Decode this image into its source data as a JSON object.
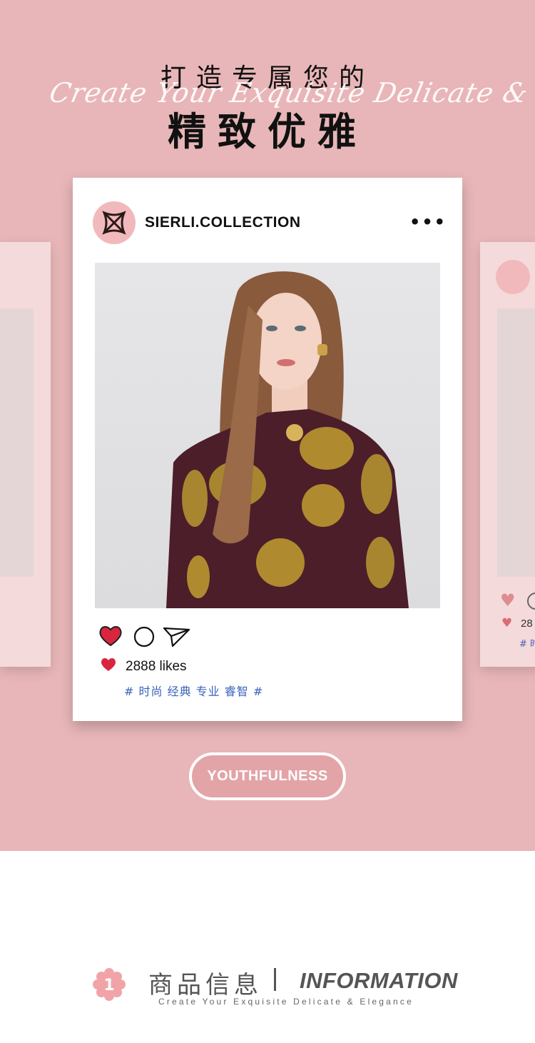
{
  "hero": {
    "title_top": "打造专属您的",
    "script_text": "Create Your Exquisite Delicate & Elegance",
    "title_main": "精致优雅"
  },
  "post": {
    "account": "SIERLI.COLLECTION",
    "more_icon": "more-dots-icon",
    "likes": "2888 likes",
    "tags": "# 时尚 经典 专业 睿智 #",
    "heart_color": "#d9253f"
  },
  "side_post": {
    "likes_partial": "28",
    "tags_partial": "# 时"
  },
  "badge": {
    "label": "YOUTHFULNESS"
  },
  "section": {
    "number": "1",
    "title_cn": "商品信息",
    "title_en": "INFORMATION",
    "subtitle": "Create Your Exquisite Delicate & Elegance"
  },
  "colors": {
    "hero_bg": "#e8b6b8",
    "accent_pink": "#f2b9bc",
    "tag_blue": "#3a63b8"
  }
}
